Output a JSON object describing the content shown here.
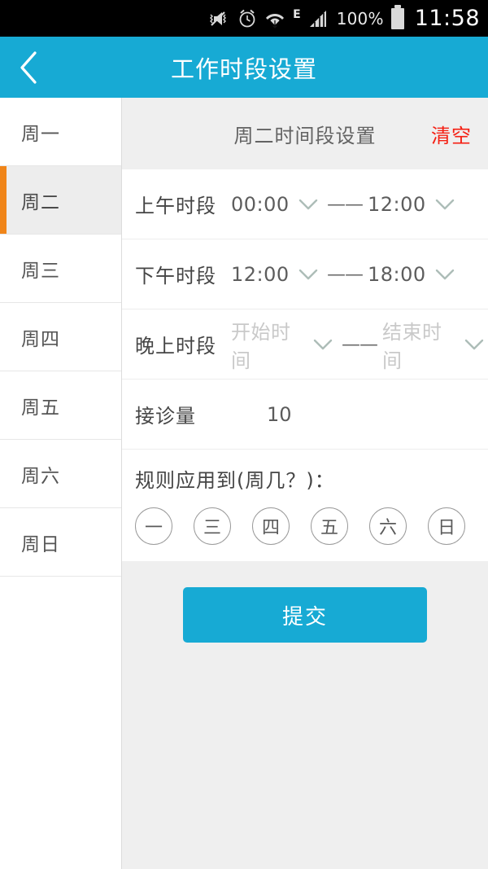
{
  "statusbar": {
    "icons": [
      "mute-vibrate-icon",
      "alarm-icon",
      "wifi-icon",
      "edge-network-icon",
      "signal-bars-icon",
      "battery-icon"
    ],
    "network_type": "E",
    "battery_percent": "100%",
    "clock": "11:58"
  },
  "appbar": {
    "back_icon": "chevron-left-icon",
    "title": "工作时段设置",
    "background": "#17aad4"
  },
  "sidebar": {
    "active_index": 1,
    "accent": "#f08519",
    "items": [
      {
        "label": "周一"
      },
      {
        "label": "周二"
      },
      {
        "label": "周三"
      },
      {
        "label": "周四"
      },
      {
        "label": "周五"
      },
      {
        "label": "周六"
      },
      {
        "label": "周日"
      }
    ]
  },
  "main": {
    "header": {
      "title": "周二时间段设置",
      "clear_label": "清空",
      "clear_color": "#f51e12"
    },
    "time_rows": [
      {
        "label": "上午时段",
        "start_value": "00:00",
        "start_placeholder": "开始时间",
        "end_value": "12:00",
        "end_placeholder": "结束时间",
        "separator": "——",
        "chevron": "chevron-down-icon"
      },
      {
        "label": "下午时段",
        "start_value": "12:00",
        "start_placeholder": "开始时间",
        "end_value": "18:00",
        "end_placeholder": "结束时间",
        "separator": "——",
        "chevron": "chevron-down-icon"
      },
      {
        "label": "晚上时段",
        "start_value": "",
        "start_placeholder": "开始时间",
        "end_value": "",
        "end_placeholder": "结束时间",
        "separator": "——",
        "chevron": "chevron-down-icon"
      }
    ],
    "capacity": {
      "label": "接诊量",
      "value": "10"
    },
    "rule": {
      "title": "规则应用到(周几？)：",
      "chips": [
        {
          "label": "一"
        },
        {
          "label": "三"
        },
        {
          "label": "四"
        },
        {
          "label": "五"
        },
        {
          "label": "六"
        },
        {
          "label": "日"
        }
      ]
    },
    "submit_label": "提交",
    "submit_color": "#17aad4",
    "background": "#efefef"
  }
}
